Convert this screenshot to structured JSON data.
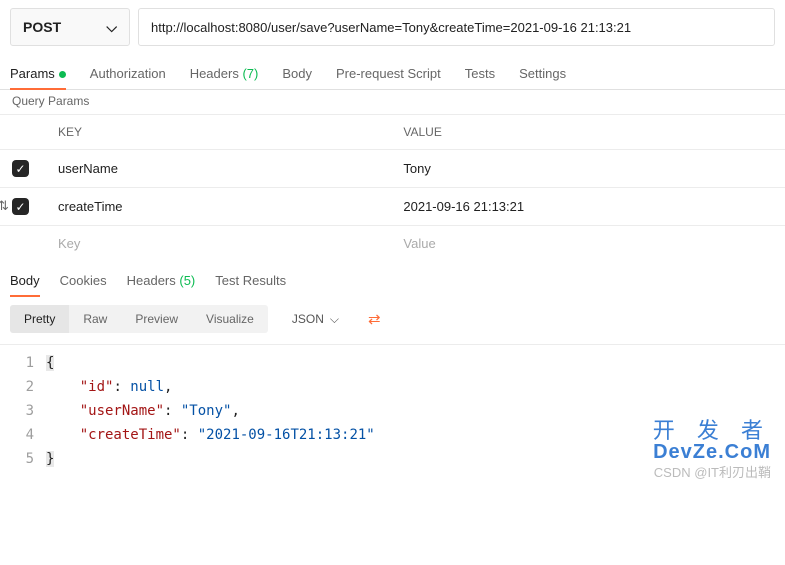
{
  "request": {
    "method": "POST",
    "url": "http://localhost:8080/user/save?userName=Tony&createTime=2021-09-16 21:13:21"
  },
  "tabs": {
    "params": "Params",
    "authorization": "Authorization",
    "headers": "Headers",
    "headers_count": "(7)",
    "body": "Body",
    "prerequest": "Pre-request Script",
    "tests": "Tests",
    "settings": "Settings"
  },
  "subtab": "Query Params",
  "table": {
    "header_key": "KEY",
    "header_value": "VALUE",
    "rows": [
      {
        "key": "userName",
        "value": "Tony",
        "checked": true
      },
      {
        "key": "createTime",
        "value": "2021-09-16 21:13:21",
        "checked": true
      }
    ],
    "placeholder_key": "Key",
    "placeholder_value": "Value"
  },
  "response_tabs": {
    "body": "Body",
    "cookies": "Cookies",
    "headers": "Headers",
    "headers_count": "(5)",
    "test_results": "Test Results"
  },
  "view_tabs": {
    "pretty": "Pretty",
    "raw": "Raw",
    "preview": "Preview",
    "visualize": "Visualize"
  },
  "format": "JSON",
  "response_body": {
    "line1": "{",
    "line2_key": "\"id\"",
    "line2_val": "null",
    "line3_key": "\"userName\"",
    "line3_val": "\"Tony\"",
    "line4_key": "\"createTime\"",
    "line4_val": "\"2021-09-16T21:13:21\"",
    "line5": "}"
  },
  "line_numbers": [
    "1",
    "2",
    "3",
    "4",
    "5"
  ],
  "watermark": {
    "line1": "开 发 者",
    "line2": "DevZe.CoM",
    "line3": "CSDN @IT利刃出鞘"
  }
}
